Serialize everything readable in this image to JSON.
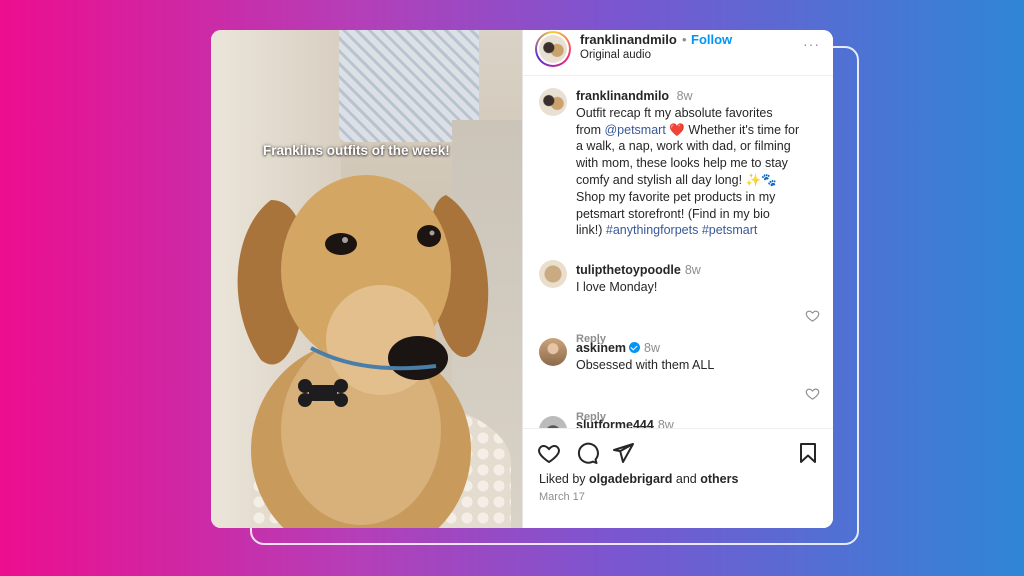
{
  "media": {
    "caption_overlay": "Franklins outfits of the week!"
  },
  "header": {
    "username": "franklinandmilo",
    "separator": "•",
    "follow_label": "Follow",
    "audio_label": "Original audio",
    "more_icon": "more-options-icon"
  },
  "caption": {
    "username": "franklinandmilo",
    "time": "8w",
    "lines": [
      "Outfit recap ft my absolute favorites",
      "from",
      "@petsmart",
      "❤️",
      "Whether it's time for",
      "a walk, a nap, work with dad, or filming",
      "with mom, these looks help me to stay",
      "comfy and stylish all day long!",
      "✨🐾",
      "Shop my favorite pet products in my",
      "petsmart storefront! (Find in my bio",
      "link!)",
      "#anythingforpets",
      "#petsmart"
    ]
  },
  "comments": [
    {
      "username": "tulipthetoypoodle",
      "time": "8w",
      "text": "I love Monday!",
      "reply": "Reply",
      "verified": false
    },
    {
      "username": "askinem",
      "time": "8w",
      "text": "Obsessed with them ALL",
      "reply": "Reply",
      "verified": true
    },
    {
      "username": "slutforme444",
      "time": "8w",
      "text": "",
      "reply": "",
      "verified": false
    }
  ],
  "actions": {
    "likes_prefix": "Liked by",
    "likes_user": "olgadebrigard",
    "likes_and": "and",
    "likes_others": "others",
    "date": "March 17"
  },
  "colors": {
    "follow": "#0095f6",
    "link": "#385898",
    "heart": "#ed4956"
  }
}
